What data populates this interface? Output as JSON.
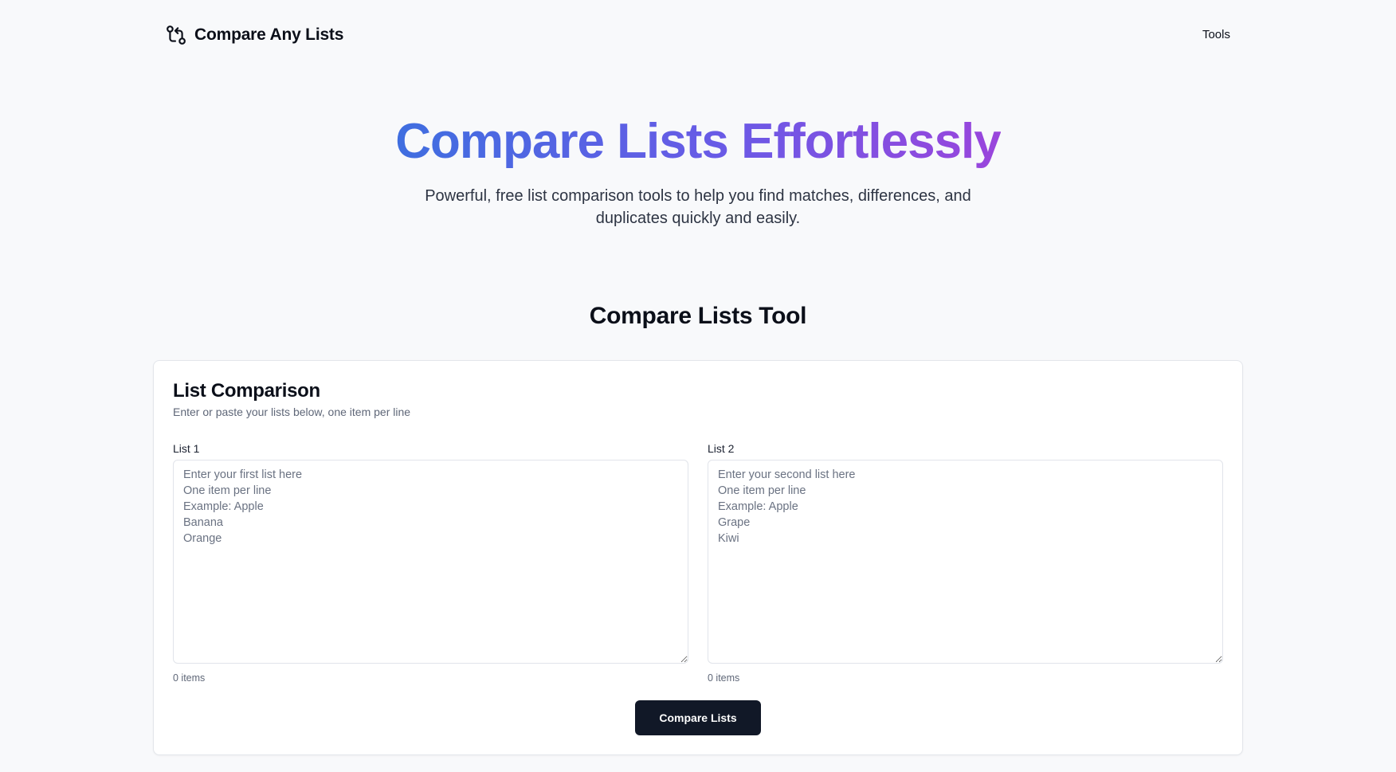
{
  "header": {
    "brand_name": "Compare Any Lists",
    "brand_icon": "git-compare-icon",
    "nav_tools": "Tools"
  },
  "hero": {
    "title": "Compare Lists Effortlessly",
    "subtitle": "Powerful, free list comparison tools to help you find matches, differences, and duplicates quickly and easily.",
    "gradient_colors": [
      "#3f6ee0",
      "#6a5ae6",
      "#9a45dc"
    ]
  },
  "section": {
    "title": "Compare Lists Tool"
  },
  "card": {
    "title": "List Comparison",
    "description": "Enter or paste your lists below, one item per line",
    "list1": {
      "label": "List 1",
      "value": "",
      "placeholder": "Enter your first list here\nOne item per line\nExample: Apple\nBanana\nOrange",
      "count": "0 items"
    },
    "list2": {
      "label": "List 2",
      "value": "",
      "placeholder": "Enter your second list here\nOne item per line\nExample: Apple\nGrape\nKiwi",
      "count": "0 items"
    },
    "compare_button": "Compare Lists",
    "button_color": "#111827"
  }
}
